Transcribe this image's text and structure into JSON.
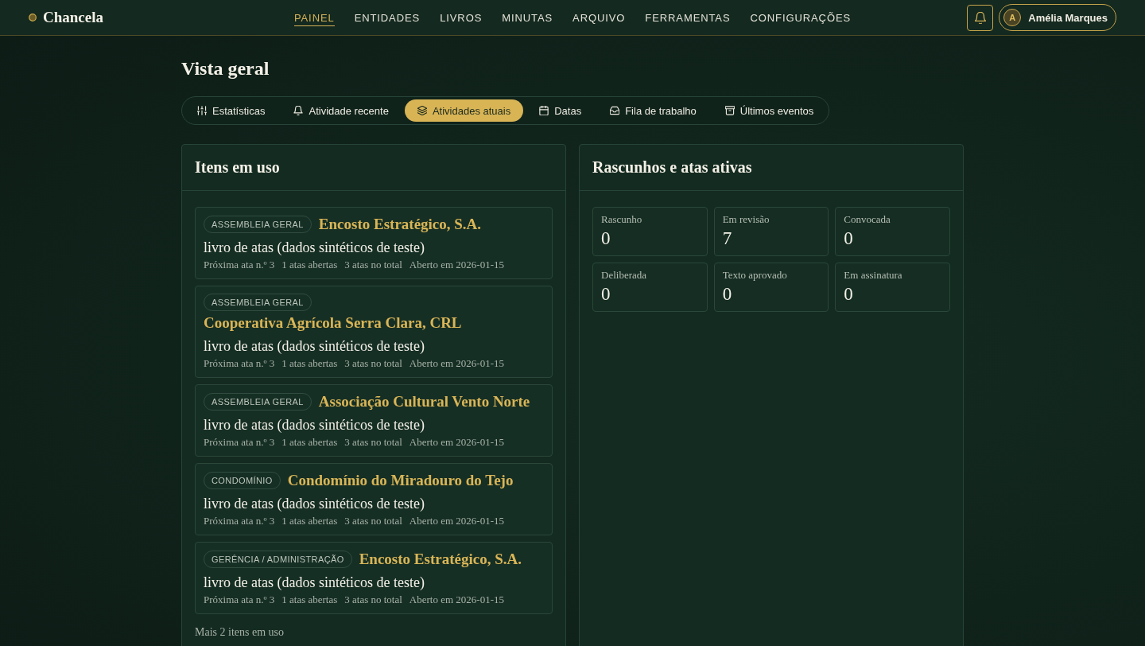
{
  "header": {
    "brand": "Chancela",
    "nav": [
      {
        "label": "PAINEL",
        "selected": true
      },
      {
        "label": "ENTIDADES",
        "selected": false
      },
      {
        "label": "LIVROS",
        "selected": false
      },
      {
        "label": "MINUTAS",
        "selected": false
      },
      {
        "label": "ARQUIVO",
        "selected": false
      },
      {
        "label": "FERRAMENTAS",
        "selected": false
      },
      {
        "label": "CONFIGURAÇÕES",
        "selected": false
      }
    ],
    "user": {
      "initial": "A",
      "name": "Amélia Marques"
    }
  },
  "page_title": "Vista geral",
  "tabs": [
    {
      "label": "Estatísticas",
      "selected": false
    },
    {
      "label": "Atividade recente",
      "selected": false
    },
    {
      "label": "Atividades atuais",
      "selected": true
    },
    {
      "label": "Datas",
      "selected": false
    },
    {
      "label": "Fila de trabalho",
      "selected": false
    },
    {
      "label": "Últimos eventos",
      "selected": false
    }
  ],
  "items_panel": {
    "title": "Itens em uso",
    "items": [
      {
        "tag": "ASSEMBLEIA GERAL",
        "entity": "Encosto Estratégico, S.A.",
        "book": "livro de atas (dados sintéticos de teste)",
        "meta": [
          "Próxima ata n.º 3",
          "1 atas abertas",
          "3 atas no total",
          "Aberto em 2026-01-15"
        ]
      },
      {
        "tag": "ASSEMBLEIA GERAL",
        "entity": "Cooperativa Agrícola Serra Clara, CRL",
        "book": "livro de atas (dados sintéticos de teste)",
        "meta": [
          "Próxima ata n.º 3",
          "1 atas abertas",
          "3 atas no total",
          "Aberto em 2026-01-15"
        ]
      },
      {
        "tag": "ASSEMBLEIA GERAL",
        "entity": "Associação Cultural Vento Norte",
        "book": "livro de atas (dados sintéticos de teste)",
        "meta": [
          "Próxima ata n.º 3",
          "1 atas abertas",
          "3 atas no total",
          "Aberto em 2026-01-15"
        ]
      },
      {
        "tag": "CONDOMÍNIO",
        "entity": "Condomínio do Miradouro do Tejo",
        "book": "livro de atas (dados sintéticos de teste)",
        "meta": [
          "Próxima ata n.º 3",
          "1 atas abertas",
          "3 atas no total",
          "Aberto em 2026-01-15"
        ]
      },
      {
        "tag": "GERÊNCIA / ADMINISTRAÇÃO",
        "entity": "Encosto Estratégico, S.A.",
        "book": "livro de atas (dados sintéticos de teste)",
        "meta": [
          "Próxima ata n.º 3",
          "1 atas abertas",
          "3 atas no total",
          "Aberto em 2026-01-15"
        ]
      }
    ],
    "more": "Mais 2 itens em uso"
  },
  "drafts_panel": {
    "title": "Rascunhos e atas ativas",
    "stats": [
      {
        "label": "Rascunho",
        "value": "0"
      },
      {
        "label": "Em revisão",
        "value": "7"
      },
      {
        "label": "Convocada",
        "value": "0"
      },
      {
        "label": "Deliberada",
        "value": "0"
      },
      {
        "label": "Texto aprovado",
        "value": "0"
      },
      {
        "label": "Em assinatura",
        "value": "0"
      }
    ]
  }
}
